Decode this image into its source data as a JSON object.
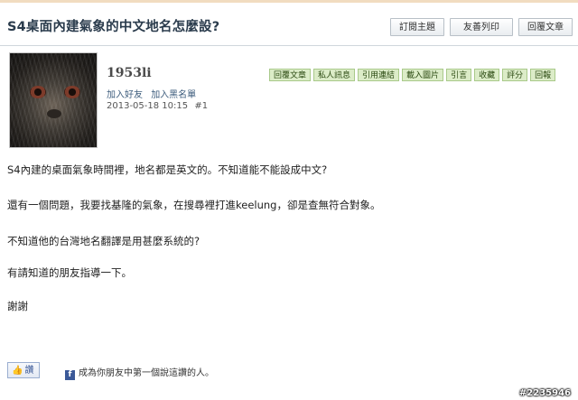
{
  "thread": {
    "title": "S4桌面內建氣象的中文地名怎麼設?",
    "top_buttons": [
      "訂閱主題",
      "友善列印",
      "回覆文章"
    ]
  },
  "post": {
    "username": "1953li",
    "user_links": [
      "加入好友",
      "加入黑名單"
    ],
    "datetime": "2013-05-18 10:15",
    "floor": "#1",
    "actions": [
      "回覆文章",
      "私人訊息",
      "引用連結",
      "載入圖片",
      "引言",
      "收藏",
      "評分",
      "回報"
    ],
    "body": [
      "S4內建的桌面氣象時間裡，地名都是英文的。不知道能不能設成中文?",
      "還有一個問題，我要找基隆的氣象，在搜尋裡打進keelung，卻是查無符合對象。",
      "不知道他的台灣地名翻譯是用甚麼系統的?",
      "有請知道的朋友指導一下。",
      "謝謝"
    ]
  },
  "footer": {
    "like_label": "讚",
    "fb_text": "成為你朋友中第一個說這讚的人。",
    "watermark": "#2235946"
  },
  "icons": {
    "facebook": "facebook-icon",
    "like": "thumbs-up-icon"
  }
}
